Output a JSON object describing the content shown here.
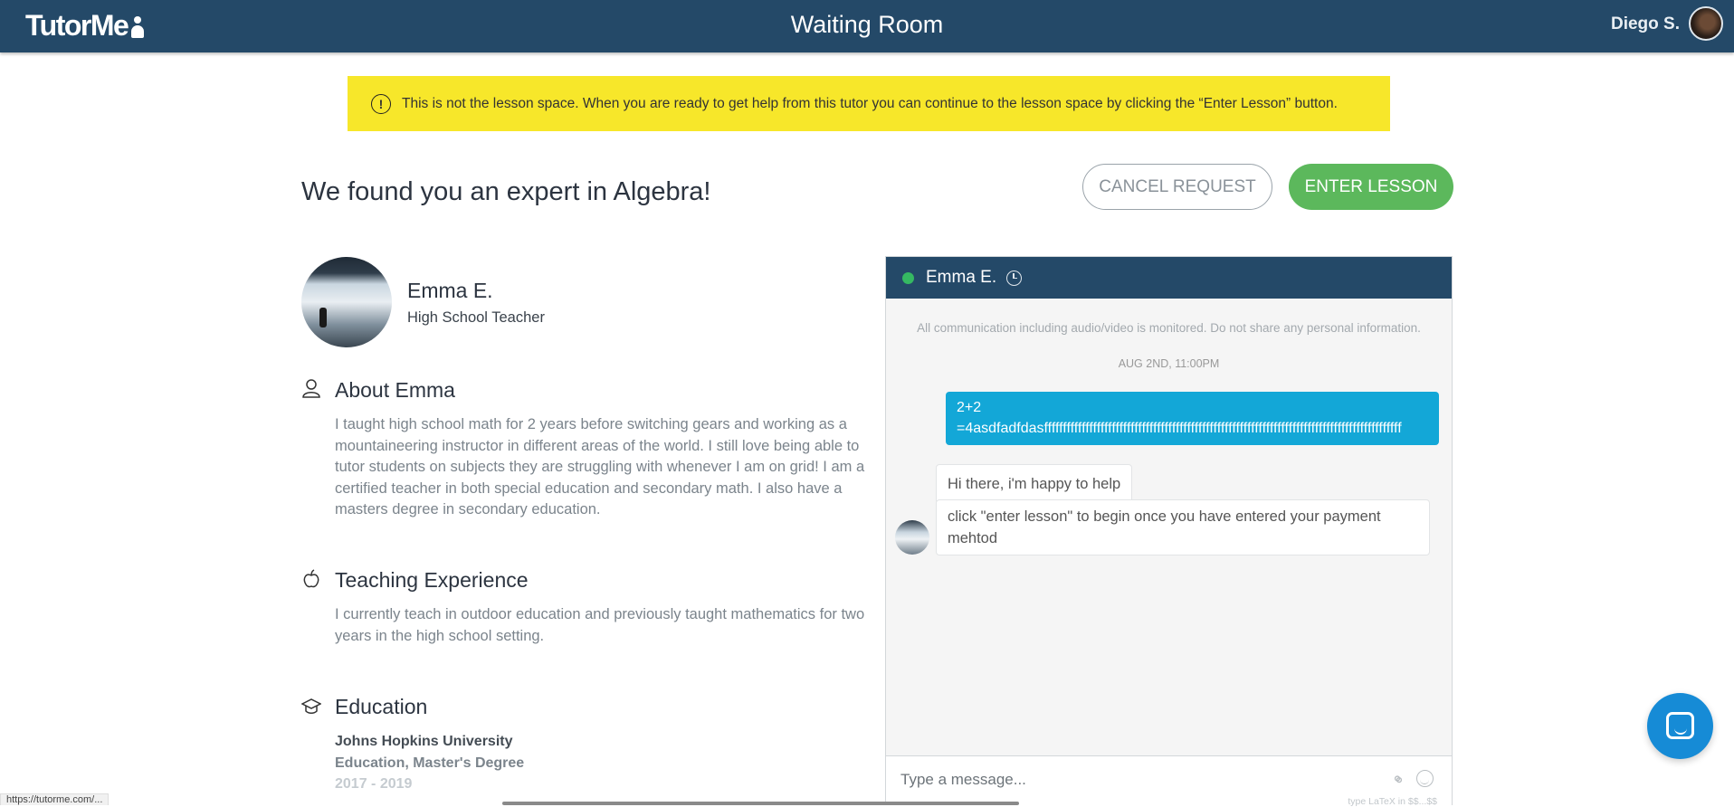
{
  "header": {
    "logo": "TutorMe",
    "title": "Waiting Room",
    "user_name": "Diego S."
  },
  "notice": {
    "text": "This is not the lesson space. When you are ready to get help from this tutor you can continue to the lesson space by clicking the “Enter Lesson” button.",
    "icon": "!"
  },
  "main": {
    "headline": "We found you an expert in Algebra!",
    "cancel_label": "CANCEL REQUEST",
    "enter_label": "ENTER LESSON"
  },
  "tutor": {
    "name": "Emma E.",
    "role": "High School Teacher",
    "about_title": "About Emma",
    "about_text": "I taught high school math for 2 years before switching gears and working as a mountaineering instructor in different areas of the world. I still love being able to tutor students on subjects they are struggling with whenever I am on grid! I am a certified teacher in both special education and secondary math. I also have a masters degree in secondary education.",
    "experience_title": "Teaching Experience",
    "experience_text": "I currently teach in outdoor education and previously taught mathematics for two years in the high school setting.",
    "education_title": "Education",
    "education": {
      "school": "Johns Hopkins University",
      "degree": "Education,  Master's Degree",
      "years": "2017 - 2019"
    }
  },
  "chat": {
    "tutor_name": "Emma E.",
    "status": "online",
    "monitor_note": "All communication including audio/video is monitored. Do not share any personal information.",
    "date_stamp": "AUG 2ND, 11:00PM",
    "messages": [
      {
        "from": "student",
        "line1": "2+2",
        "line2": "=4asdfadfdasfffffffffffffffffffffffffffffffffffffffffffffffffffffffffffffffffffffffffffffffffffffffffffffff"
      },
      {
        "from": "tutor",
        "text": "Hi there, i'm happy to help"
      },
      {
        "from": "tutor",
        "text": "click \"enter lesson\" to begin once you have entered your payment mehtod"
      }
    ],
    "input_placeholder": "Type a message...",
    "latex_hint": "type LaTeX in $$...$$"
  },
  "statusbar": {
    "url": "https://tutorme.com/..."
  },
  "colors": {
    "header_bg": "#244968",
    "notice_bg": "#f7e72a",
    "enter_button": "#5cb85c",
    "outgoing_bubble": "#13a7d7",
    "online_dot": "#35b862",
    "intercom": "#168bd6"
  },
  "icons": {
    "logo": "person-icon",
    "notice": "exclamation-circle-icon",
    "about": "user-outline-icon",
    "experience": "apple-icon",
    "education": "graduation-cap-icon",
    "chat_status": "clock-icon",
    "attach": "paperclip-icon",
    "emoji": "smiley-icon",
    "intercom": "chat-bubble-icon"
  }
}
